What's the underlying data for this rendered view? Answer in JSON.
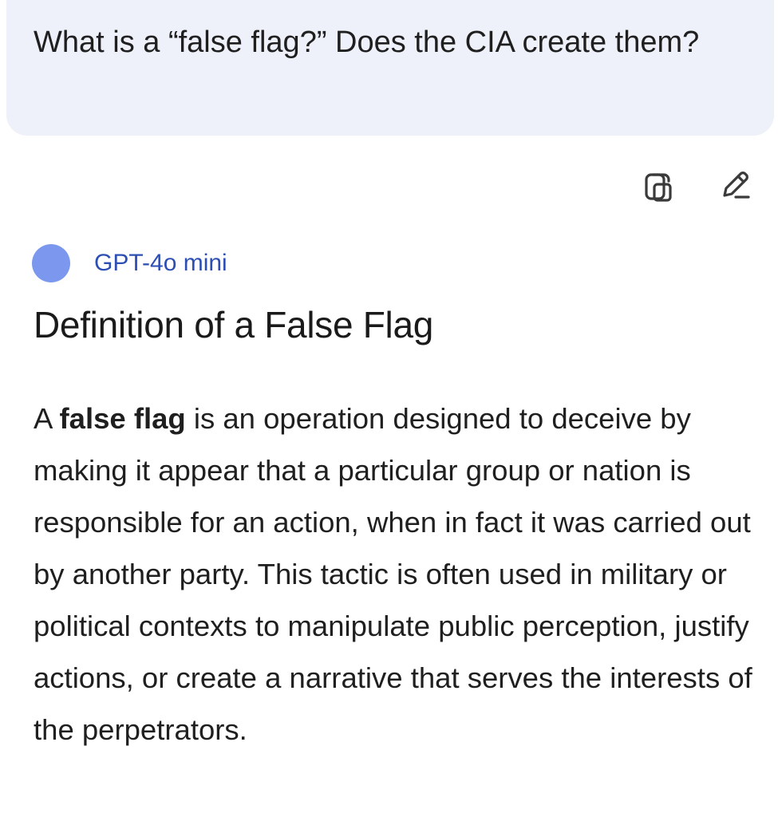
{
  "user_message": {
    "text": "What is a “false flag?” Does the CIA create them?"
  },
  "message_actions": {
    "copy_icon": "copy-icon",
    "edit_icon": "edit-pencil-icon"
  },
  "assistant": {
    "model_name": "GPT-4o mini",
    "avatar_color": "#7b98ee",
    "heading": "Definition of a False Flag",
    "paragraph": {
      "prefix": "A ",
      "bold_term": "false flag",
      "rest": " is an operation designed to deceive by making it appear that a particular group or nation is responsible for an action, when in fact it was carried out by another party. This tactic is often used in military or political contexts to manipulate public perception, justify actions, or create a narrative that serves the interests of the perpetrators."
    }
  },
  "colors": {
    "user_bubble_bg": "#eef0fa",
    "model_name_color": "#2d4fb3"
  }
}
